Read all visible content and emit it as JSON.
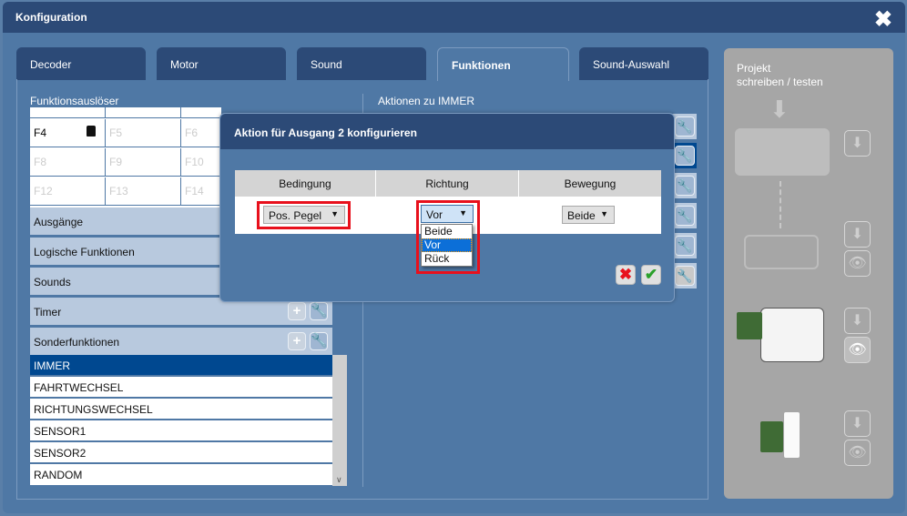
{
  "window": {
    "title": "Konfiguration",
    "close_icon": "close-icon"
  },
  "tabs": [
    {
      "label": "Decoder"
    },
    {
      "label": "Motor"
    },
    {
      "label": "Sound"
    },
    {
      "label": "Funktionen",
      "active": true
    },
    {
      "label": "Sound-Auswahl"
    }
  ],
  "left": {
    "title": "Funktionsauslöser",
    "grid": [
      {
        "label": "F4",
        "active": true
      },
      {
        "label": "F5"
      },
      {
        "label": "F6"
      },
      {
        "label": "F8"
      },
      {
        "label": "F9"
      },
      {
        "label": "F10"
      },
      {
        "label": "F12"
      },
      {
        "label": "F13"
      },
      {
        "label": "F14"
      }
    ],
    "sections": [
      {
        "label": "Ausgänge"
      },
      {
        "label": "Logische Funktionen"
      },
      {
        "label": "Sounds"
      },
      {
        "label": "Timer"
      },
      {
        "label": "Sonderfunktionen"
      }
    ],
    "items": [
      {
        "label": "IMMER",
        "selected": true
      },
      {
        "label": "FAHRTWECHSEL"
      },
      {
        "label": "RICHTUNGSWECHSEL"
      },
      {
        "label": "SENSOR1"
      },
      {
        "label": "SENSOR2"
      },
      {
        "label": "RANDOM"
      }
    ]
  },
  "right": {
    "title": "Aktionen zu IMMER"
  },
  "dialog": {
    "title": "Aktion für Ausgang 2 konfigurieren",
    "columns": [
      "Bedingung",
      "Richtung",
      "Bewegung"
    ],
    "bedingung": "Pos. Pegel",
    "richtung": "Vor",
    "bewegung": "Beide",
    "richtung_options": [
      "Beide",
      "Vor",
      "Rück"
    ],
    "cancel_icon": "x-icon",
    "ok_icon": "check-icon"
  },
  "side": {
    "title_line1": "Projekt",
    "title_line2": "schreiben / testen"
  },
  "colors": {
    "header": "#2c4a77",
    "body": "#4f78a5",
    "selected": "#004890",
    "highlight": "#e8101c"
  }
}
